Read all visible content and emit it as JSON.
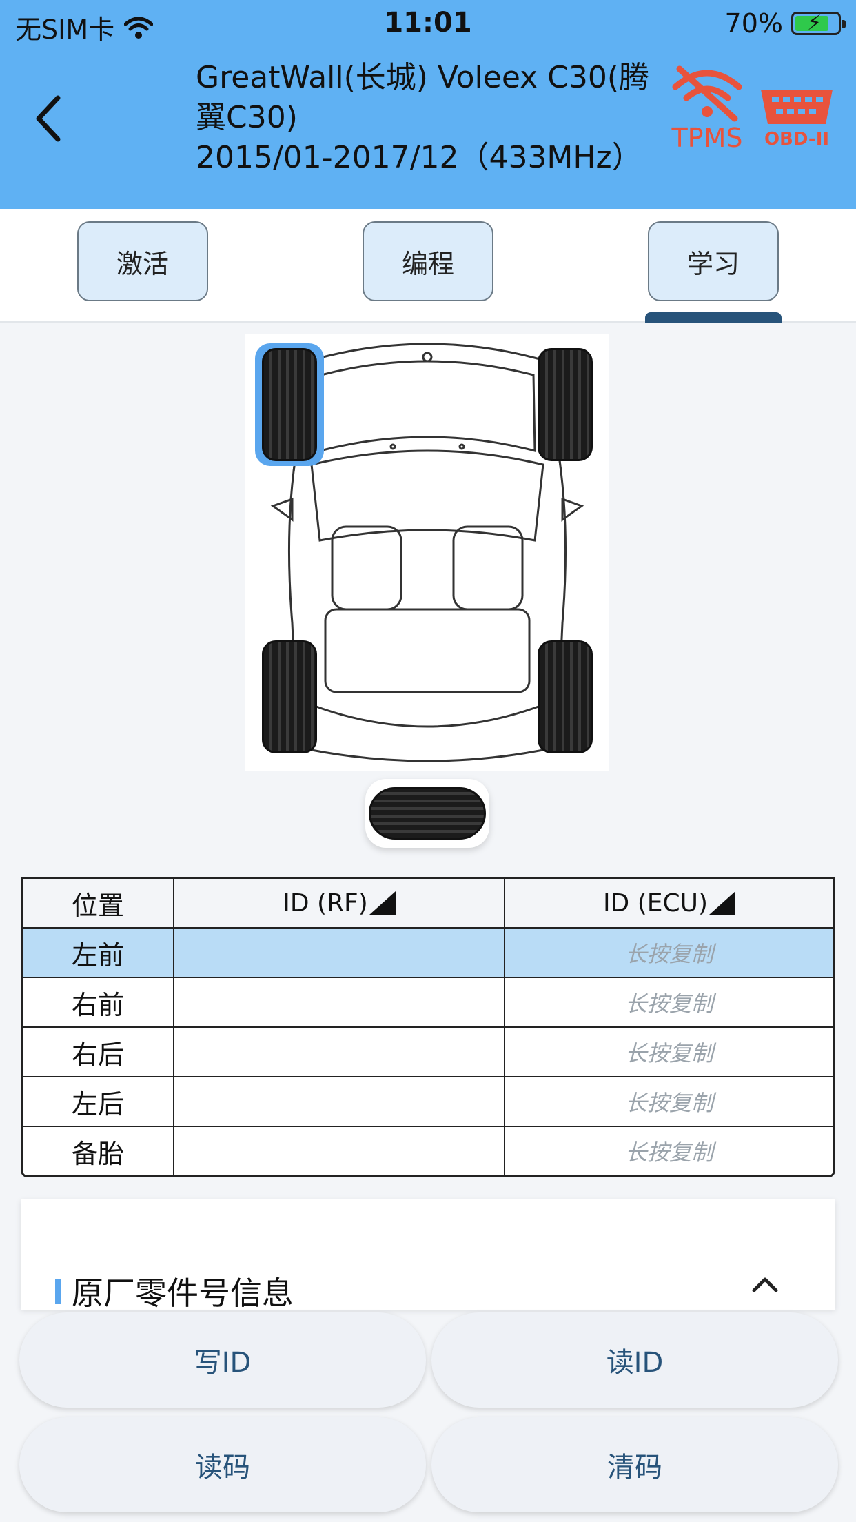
{
  "status_bar": {
    "carrier": "无SIM卡",
    "time": "11:01",
    "battery": "70%"
  },
  "header": {
    "title_line1": "GreatWall(长城) Voleex C30(腾",
    "title_line2": "翼C30)",
    "title_line3": "2015/01-2017/12（433MHz）",
    "tpms_label": "TPMS",
    "obd_label": "OBD-II",
    "accent": "#5fb1f3",
    "alert_color": "#e8533c"
  },
  "tabs": {
    "items": [
      {
        "label": "激活"
      },
      {
        "label": "编程"
      },
      {
        "label": "学习"
      }
    ],
    "active": 2
  },
  "table": {
    "headers": {
      "position": "位置",
      "rf": "ID (RF)",
      "ecu": "ID (ECU)"
    },
    "rows": [
      {
        "position": "左前",
        "rf": "",
        "ecu": "长按复制",
        "selected": true
      },
      {
        "position": "右前",
        "rf": "",
        "ecu": "长按复制"
      },
      {
        "position": "右后",
        "rf": "",
        "ecu": "长按复制"
      },
      {
        "position": "左后",
        "rf": "",
        "ecu": "长按复制"
      },
      {
        "position": "备胎",
        "rf": "",
        "ecu": "长按复制"
      }
    ]
  },
  "info_card": {
    "title": "原厂零件号信息"
  },
  "buttons": {
    "write_id": "写ID",
    "read_id": "读ID",
    "read_code": "读码",
    "clear_code": "清码"
  }
}
